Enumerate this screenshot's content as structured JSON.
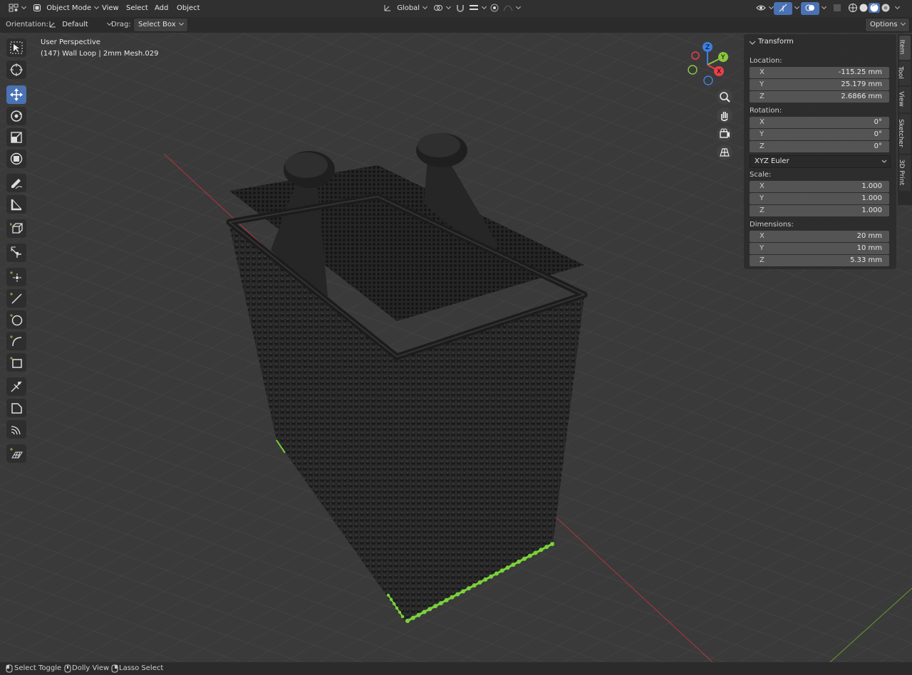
{
  "header": {
    "editor_type_icon": "grid-icon",
    "mode": "Object Mode",
    "menus": [
      "View",
      "Select",
      "Add",
      "Object"
    ],
    "transform_orientation": "Global"
  },
  "tool_header": {
    "orientation_label": "Orientation:",
    "orientation_value": "Default",
    "drag_label": "Drag:",
    "drag_value": "Select Box",
    "options": "Options"
  },
  "viewport": {
    "perspective": "User Perspective",
    "object_info": "(147) Wall Loop | 2mm Mesh.029",
    "gizmo_axes": [
      "X",
      "Y",
      "Z"
    ],
    "colors": {
      "x_axis": "#e8404a",
      "y_axis": "#8bc53f",
      "z_axis": "#3d7fe0",
      "selection": "#7bd13a"
    }
  },
  "transform": {
    "title": "Transform",
    "location_label": "Location:",
    "location": {
      "x": "-115.25 mm",
      "y": "25.179 mm",
      "z": "2.6866 mm"
    },
    "rotation_label": "Rotation:",
    "rotation": {
      "x": "0°",
      "y": "0°",
      "z": "0°"
    },
    "rotation_mode": "XYZ Euler",
    "scale_label": "Scale:",
    "scale": {
      "x": "1.000",
      "y": "1.000",
      "z": "1.000"
    },
    "dimensions_label": "Dimensions:",
    "dimensions": {
      "x": "20 mm",
      "y": "10 mm",
      "z": "5.33 mm"
    }
  },
  "sidebar_tabs": [
    "Item",
    "Tool",
    "View",
    "Sketcher",
    "3D Print"
  ],
  "status_bar": {
    "left": "Select Toggle",
    "middle": "Dolly View",
    "right": "Lasso Select"
  }
}
